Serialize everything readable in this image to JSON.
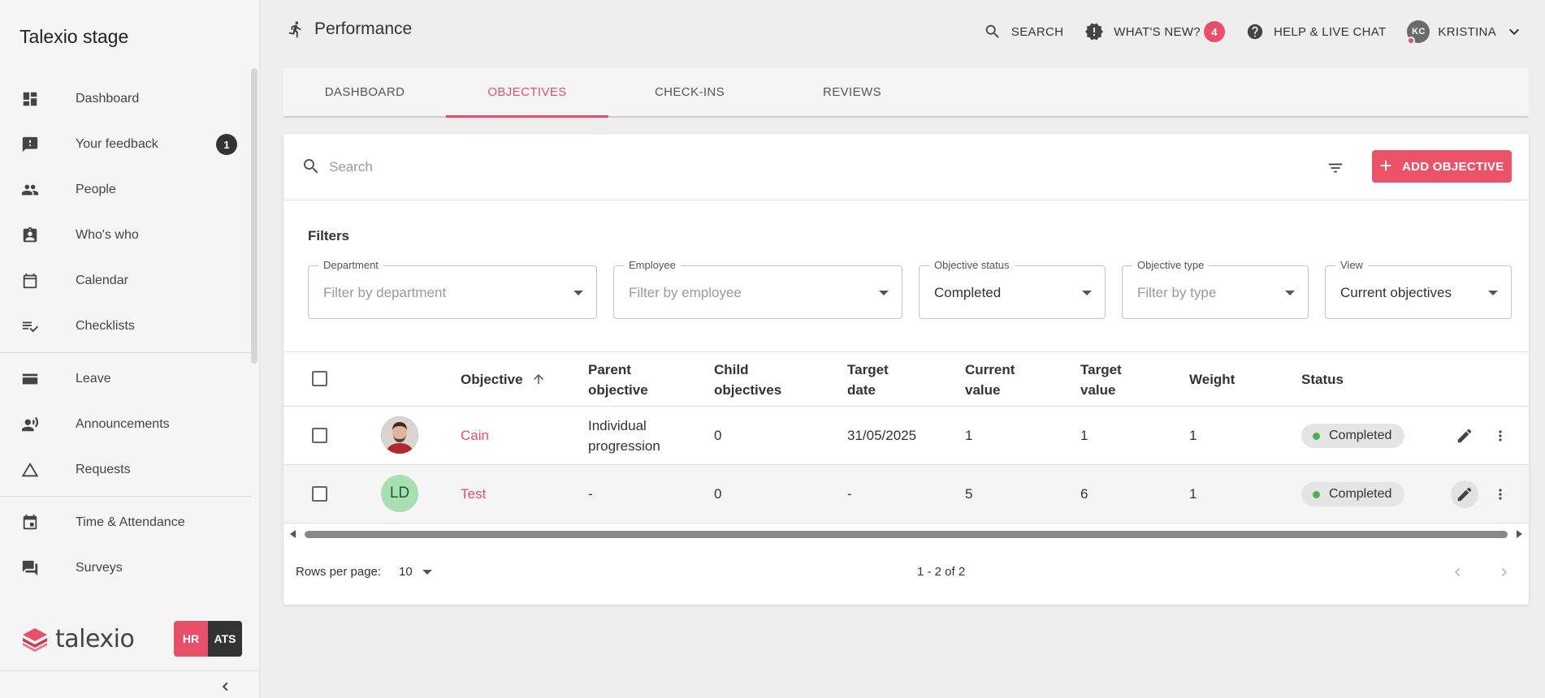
{
  "app": {
    "title": "Talexio stage"
  },
  "sidebar": {
    "items": [
      {
        "label": "Dashboard",
        "icon": "dashboard-icon"
      },
      {
        "label": "Your feedback",
        "icon": "feedback-icon",
        "badge": "1"
      },
      {
        "label": "People",
        "icon": "people-icon"
      },
      {
        "label": "Who's who",
        "icon": "contacts-icon"
      },
      {
        "label": "Calendar",
        "icon": "calendar-icon"
      },
      {
        "label": "Checklists",
        "icon": "checklist-icon"
      },
      {
        "label": "Leave",
        "icon": "leave-icon"
      },
      {
        "label": "Announcements",
        "icon": "announcements-icon"
      },
      {
        "label": "Requests",
        "icon": "requests-icon"
      },
      {
        "label": "Time & Attendance",
        "icon": "time-attendance-icon"
      },
      {
        "label": "Surveys",
        "icon": "surveys-icon"
      }
    ],
    "logo_text": "talexio",
    "module_hr": "HR",
    "module_ats": "ATS"
  },
  "header": {
    "title": "Performance",
    "search_label": "SEARCH",
    "whats_new_label": "WHAT'S NEW?",
    "whats_new_count": "4",
    "help_label": "HELP & LIVE CHAT",
    "user_initials": "KC",
    "user_name": "KRISTINA"
  },
  "tabs": [
    {
      "label": "DASHBOARD",
      "active": false
    },
    {
      "label": "OBJECTIVES",
      "active": true
    },
    {
      "label": "CHECK-INS",
      "active": false
    },
    {
      "label": "REVIEWS",
      "active": false
    }
  ],
  "toolbar": {
    "search_placeholder": "Search",
    "add_label": "ADD OBJECTIVE"
  },
  "filters": {
    "title": "Filters",
    "department": {
      "label": "Department",
      "value": "",
      "placeholder": "Filter by department"
    },
    "employee": {
      "label": "Employee",
      "value": "",
      "placeholder": "Filter by employee"
    },
    "status": {
      "label": "Objective status",
      "value": "Completed"
    },
    "type": {
      "label": "Objective type",
      "value": "",
      "placeholder": "Filter by type"
    },
    "view": {
      "label": "View",
      "value": "Current objectives"
    }
  },
  "table": {
    "headers": {
      "objective": "Objective",
      "parent_1": "Parent",
      "parent_2": "objective",
      "child_1": "Child",
      "child_2": "objectives",
      "target_date_1": "Target",
      "target_date_2": "date",
      "current_1": "Current",
      "current_2": "value",
      "target_value_1": "Target",
      "target_value_2": "value",
      "weight": "Weight",
      "status": "Status"
    },
    "rows": [
      {
        "avatar_type": "photo",
        "objective": "Cain",
        "parent_1": "Individual",
        "parent_2": "progression",
        "child": "0",
        "target_date": "31/05/2025",
        "current": "1",
        "target_value": "1",
        "weight": "1",
        "status": "Completed"
      },
      {
        "avatar_type": "initials",
        "initials": "LD",
        "objective": "Test",
        "parent_1": "-",
        "parent_2": "",
        "child": "0",
        "target_date": "-",
        "current": "5",
        "target_value": "6",
        "weight": "1",
        "status": "Completed"
      }
    ]
  },
  "pagination": {
    "rows_per_page_label": "Rows per page:",
    "rows_per_page": "10",
    "range": "1 - 2 of 2"
  },
  "colors": {
    "accent": "#e8506a",
    "status_green": "#4caf50"
  }
}
